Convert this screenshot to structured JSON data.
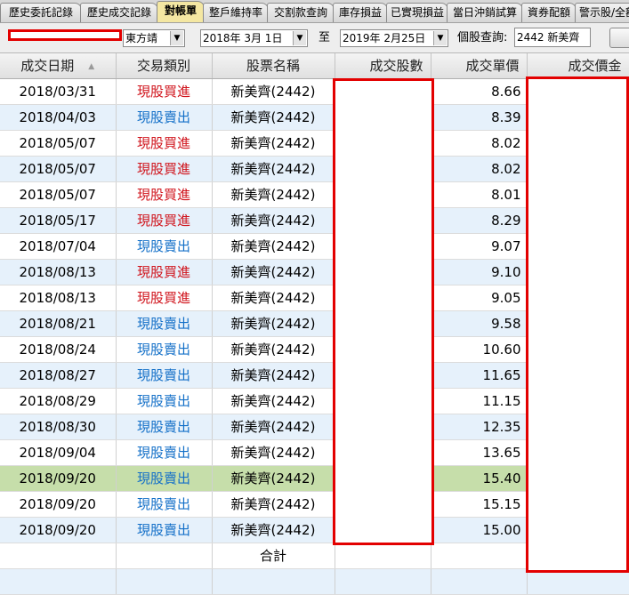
{
  "tabs": [
    {
      "label": "歷史委託記錄",
      "active": false
    },
    {
      "label": "歷史成交記錄",
      "active": false
    },
    {
      "label": "對帳單",
      "active": true
    },
    {
      "label": "整戶維持率",
      "active": false
    },
    {
      "label": "交割款查詢",
      "active": false
    },
    {
      "label": "庫存損益",
      "active": false
    },
    {
      "label": "已實現損益",
      "active": false
    },
    {
      "label": "當日沖銷試算",
      "active": false
    },
    {
      "label": "資券配額",
      "active": false
    },
    {
      "label": "警示股/全額",
      "active": false
    }
  ],
  "toolbar": {
    "account_name": "東方靖",
    "start_date": "2018年  3月  1日",
    "range_label": "至",
    "end_date": "2019年  2月25日",
    "query_label": "個股查詢:",
    "query_value": "2442 新美齊"
  },
  "table": {
    "columns": [
      "成交日期",
      "交易類別",
      "股票名稱",
      "成交股數",
      "成交單價",
      "成交價金"
    ],
    "rows": [
      {
        "date": "2018/03/31",
        "type": "現股買進",
        "side": "buy",
        "stock": "新美齊(2442)",
        "price": "8.66"
      },
      {
        "date": "2018/04/03",
        "type": "現股賣出",
        "side": "sell",
        "stock": "新美齊(2442)",
        "price": "8.39"
      },
      {
        "date": "2018/05/07",
        "type": "現股買進",
        "side": "buy",
        "stock": "新美齊(2442)",
        "price": "8.02"
      },
      {
        "date": "2018/05/07",
        "type": "現股買進",
        "side": "buy",
        "stock": "新美齊(2442)",
        "price": "8.02"
      },
      {
        "date": "2018/05/07",
        "type": "現股買進",
        "side": "buy",
        "stock": "新美齊(2442)",
        "price": "8.01"
      },
      {
        "date": "2018/05/17",
        "type": "現股買進",
        "side": "buy",
        "stock": "新美齊(2442)",
        "price": "8.29"
      },
      {
        "date": "2018/07/04",
        "type": "現股賣出",
        "side": "sell",
        "stock": "新美齊(2442)",
        "price": "9.07"
      },
      {
        "date": "2018/08/13",
        "type": "現股買進",
        "side": "buy",
        "stock": "新美齊(2442)",
        "price": "9.10"
      },
      {
        "date": "2018/08/13",
        "type": "現股買進",
        "side": "buy",
        "stock": "新美齊(2442)",
        "price": "9.05"
      },
      {
        "date": "2018/08/21",
        "type": "現股賣出",
        "side": "sell",
        "stock": "新美齊(2442)",
        "price": "9.58"
      },
      {
        "date": "2018/08/24",
        "type": "現股賣出",
        "side": "sell",
        "stock": "新美齊(2442)",
        "price": "10.60"
      },
      {
        "date": "2018/08/27",
        "type": "現股賣出",
        "side": "sell",
        "stock": "新美齊(2442)",
        "price": "11.65"
      },
      {
        "date": "2018/08/29",
        "type": "現股賣出",
        "side": "sell",
        "stock": "新美齊(2442)",
        "price": "11.15"
      },
      {
        "date": "2018/08/30",
        "type": "現股賣出",
        "side": "sell",
        "stock": "新美齊(2442)",
        "price": "12.35"
      },
      {
        "date": "2018/09/04",
        "type": "現股賣出",
        "side": "sell",
        "stock": "新美齊(2442)",
        "price": "13.65"
      },
      {
        "date": "2018/09/20",
        "type": "現股賣出",
        "side": "sell",
        "stock": "新美齊(2442)",
        "price": "15.40",
        "selected": true
      },
      {
        "date": "2018/09/20",
        "type": "現股賣出",
        "side": "sell",
        "stock": "新美齊(2442)",
        "price": "15.15"
      },
      {
        "date": "2018/09/20",
        "type": "現股賣出",
        "side": "sell",
        "stock": "新美齊(2442)",
        "price": "15.00"
      }
    ],
    "total_label": "合計"
  },
  "colors": {
    "buy": "#d0141c",
    "sell": "#1470c8",
    "active_tab": "#f4e7a2",
    "selected_row": "#c6deaa",
    "alt_row": "#e6f1fb",
    "redaction_border": "#e30000"
  }
}
